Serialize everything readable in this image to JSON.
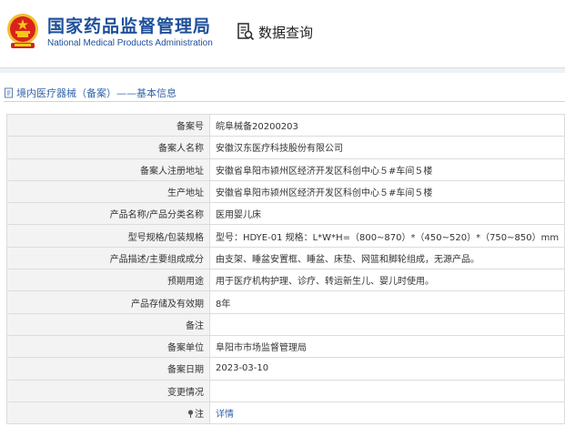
{
  "header": {
    "org_name_cn": "国家药品监督管理局",
    "org_name_en": "National Medical Products Administration",
    "emblem_icon": "national-emblem-icon",
    "query_icon": "data-query-icon",
    "query_label": "数据查询"
  },
  "breadcrumb": {
    "icon": "document-icon",
    "text": "境内医疗器械（备案）——基本信息"
  },
  "details": [
    {
      "label": "备案号",
      "value": "皖阜械备20200203"
    },
    {
      "label": "备案人名称",
      "value": "安徽汉东医疗科技股份有限公司"
    },
    {
      "label": "备案人注册地址",
      "value": "安徽省阜阳市颍州区经济开发区科创中心５#车间５楼"
    },
    {
      "label": "生产地址",
      "value": "安徽省阜阳市颍州区经济开发区科创中心５#车间５楼"
    },
    {
      "label": "产品名称/产品分类名称",
      "value": "医用婴儿床"
    },
    {
      "label": "型号规格/包装规格",
      "value": "型号：HDYE-01 规格：L*W*H=（800~870）*（450~520）*（750~850）mm"
    },
    {
      "label": "产品描述/主要组成成分",
      "value": "由支架、睡盆安置框、睡盆、床垫、网篮和脚轮组成，无源产品。"
    },
    {
      "label": "预期用途",
      "value": "用于医疗机构护理、诊疗、转运新生儿、婴儿时使用。"
    },
    {
      "label": "产品存储及有效期",
      "value": "8年"
    },
    {
      "label": "备注",
      "value": ""
    },
    {
      "label": "备案单位",
      "value": "阜阳市市场监督管理局"
    },
    {
      "label": "备案日期",
      "value": "2023-03-10"
    },
    {
      "label": "变更情况",
      "value": ""
    },
    {
      "label": "注",
      "value": "详情",
      "label_icon": "pin-icon"
    }
  ],
  "colors": {
    "brand_blue": "#1d4f9c",
    "link_blue": "#3565a8",
    "emblem_red": "#d8231b",
    "emblem_gold": "#f5c518"
  }
}
